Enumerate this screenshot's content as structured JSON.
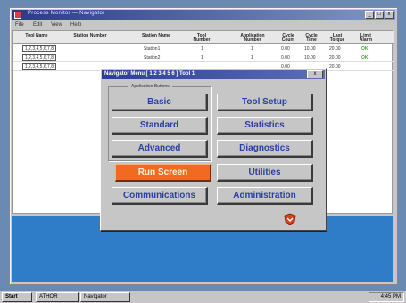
{
  "app": {
    "title": "Process Monitor — Navigator",
    "menu": [
      "File",
      "Edit",
      "View",
      "Help"
    ],
    "controls": [
      "_",
      "□",
      "x"
    ]
  },
  "table": {
    "headers": [
      "Tool Name",
      "Station Number",
      "Station Name",
      "Tool Number",
      "Application Number",
      "Cycle Count",
      "Cycle Time",
      "Last Torque",
      "Limit Alarm"
    ],
    "rows": [
      {
        "id": "1,2,3,4,5,6,7,8",
        "station": "Station1",
        "tool": "1",
        "app": "1",
        "count": "0.00",
        "time": "10.00",
        "torque": "20.00",
        "alarm": "OK"
      },
      {
        "id": "1,2,3,4,5,6,7,8",
        "station": "Station2",
        "tool": "1",
        "app": "1",
        "count": "0.00",
        "time": "10.00",
        "torque": "20.00",
        "alarm": "OK"
      },
      {
        "id": "1,2,3,4,5,6,7,8",
        "station": "",
        "tool": "",
        "app": "",
        "count": "0.00",
        "time": "",
        "torque": "20.00",
        "alarm": ""
      }
    ]
  },
  "dialog": {
    "title": "Navigator Menu  [ 1 2 3 4 5 6 ]  Tool 1",
    "close": "x",
    "group_label": "Application Buttons",
    "buttons": {
      "basic": "Basic",
      "standard": "Standard",
      "advanced": "Advanced",
      "run_screen": "Run Screen",
      "communications": "Communications",
      "tool_setup": "Tool Setup",
      "statistics": "Statistics",
      "diagnostics": "Diagnostics",
      "utilities": "Utilities",
      "administration": "Administration"
    },
    "active_button": "run_screen",
    "colors": {
      "button_text": "#2a3fa0",
      "active_bg": "#f26a22"
    }
  },
  "taskbar": {
    "start": "Start",
    "tasks": [
      "ATHOR",
      "Navigator"
    ],
    "clock": "4:45 PM"
  },
  "colors": {
    "desktop": "#6a8ab4",
    "blue_area": "#2f7cc8",
    "title_bar": "#2a3a8c"
  }
}
